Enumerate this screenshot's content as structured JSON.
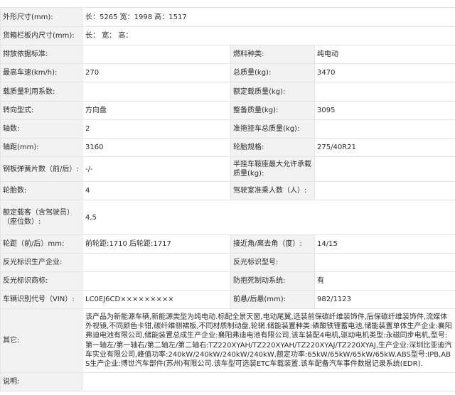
{
  "rows": {
    "dims_label": "外形尺寸(mm):",
    "dims_value": "长：5265 宽：1998 高：1517",
    "cargo_label": "货箱栏板内尺寸(mm):",
    "cargo_value": "长：  宽：  高：",
    "emission_label": "排放依据标准:",
    "emission_value": "",
    "fuel_label": "燃料种类:",
    "fuel_value": "纯电动",
    "speed_label": "最高车速(km/h):",
    "speed_value": "270",
    "total_mass_label": "总质量(kg):",
    "total_mass_value": "3470",
    "load_coef_label": "载质量利用系数:",
    "load_coef_value": "",
    "rated_load_label": "额定载质量(kg):",
    "rated_load_value": "",
    "steering_label": "转向型式:",
    "steering_value": "方向盘",
    "curb_mass_label": "整备质量(kg):",
    "curb_mass_value": "3095",
    "axles_label": "轴数:",
    "axles_value": "2",
    "trailer_mass_label": "准拖挂车总质量(kg):",
    "trailer_mass_value": "",
    "wheelbase_label": "轴距(mm):",
    "wheelbase_value": "3160",
    "tire_spec_label": "轮胎规格:",
    "tire_spec_value": "275/40R21",
    "spring_label": "钢板弹簧片数（前/后）:",
    "spring_value": "-/-",
    "saddle_label": "半挂车鞍座最大允许承载质量(kg):",
    "saddle_value": "",
    "tire_count_label": "轮胎数:",
    "tire_count_value": "4",
    "cab_label": "驾驶室准乘人数（人）:",
    "cab_value": "",
    "seats_label": "额定载客（含驾驶员）（座位数）:",
    "seats_value": "4,5",
    "track_label": "轮距（前/后）mm:",
    "track_value": "前轮距:1710 后轮距:1717",
    "angle_label": "接近角/离去角（度）:",
    "angle_value": "14/15",
    "reflect_maker_label": "反光标识生产企业:",
    "reflect_maker_value": "",
    "reflect_model_label": "反光标识型号:",
    "reflect_model_value": "",
    "reflect_brand_label": "反光标识商标:",
    "reflect_brand_value": "",
    "abs_label": "防抱死制动系统:",
    "abs_value": "有",
    "vin_label": "车辆识别代号（VIN）:",
    "vin_value": "LC0EJ6CD×××××××××",
    "overhang_label": "前悬/后悬(mm):",
    "overhang_value": "982/1123",
    "other_label": "其它:",
    "other_value": "该产品为新能源车辆,新能源类型为纯电动.标配全景天窗,电动尾翼,选装前保碳纤维装饰件,后保碳纤维装饰件,流媒体外视镜,不同颜色卡钳,碳纤维侧裙板,不同材质制动盘,轮辋.储能装置种类:磷酸铁锂蓄电池,储能装置单体生产企业:襄阳弗迪电池有限公司,储能装置总成生产企业:襄阳弗迪电池有限公司.该车装配4电机,驱动电机类型:永磁同步电机,型号:第一轴左/第一轴右/第二轴左/第二轴右:TZ220XYAH/TZ220XYAH/TZ220XYAJ/TZ220XYAJ,生产企业:深圳比亚迪汽车实业有限公司,峰值功率:240kW/240kW/240kW/240kW,额定功率:65kW/65kW/65kW/65kW.ABS型号:IPB,ABS生产企业:博世汽车部件(苏州)有限公司.该车型可选装ETC车载装置.该车配备汽车事件数据记录系统(EDR).",
    "note_label": "说明:",
    "note_value": ""
  }
}
